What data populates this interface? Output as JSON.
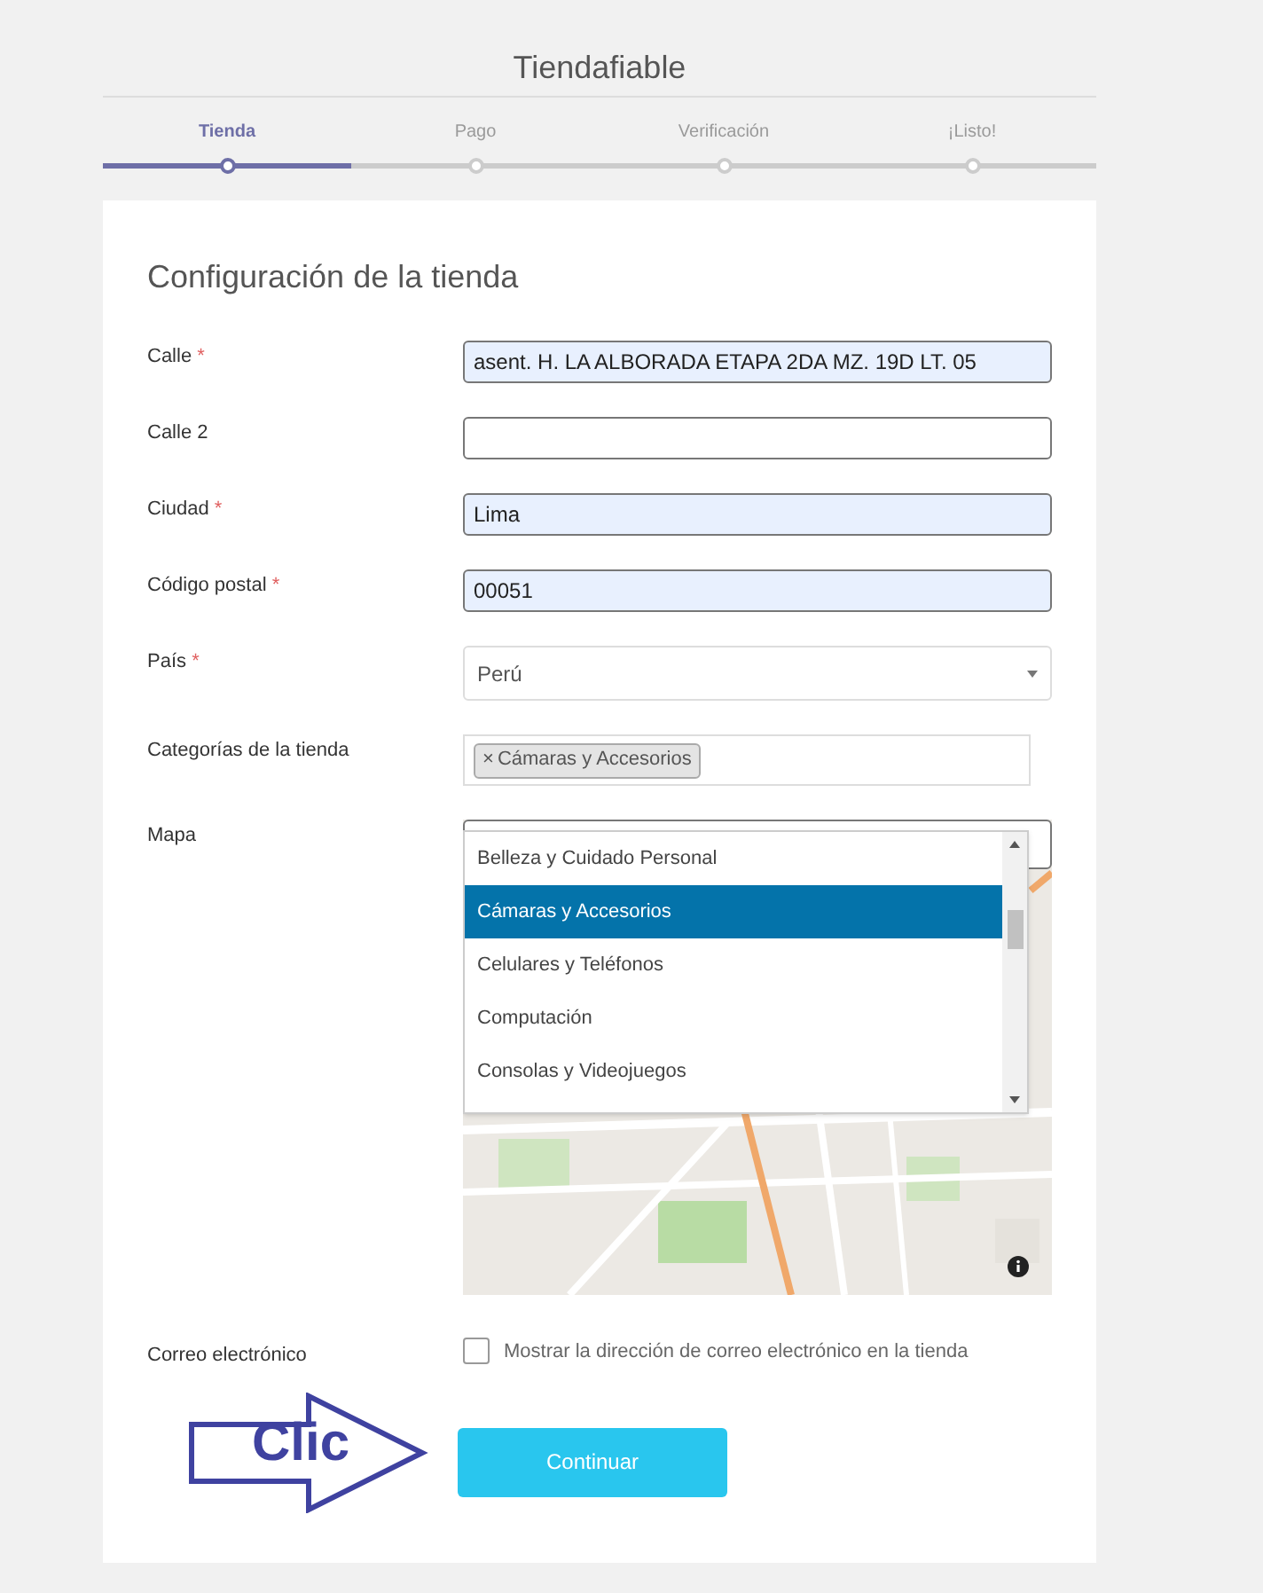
{
  "title": "Tiendafiable",
  "steps": [
    {
      "label": "Tienda",
      "selected": true
    },
    {
      "label": "Pago",
      "selected": false
    },
    {
      "label": "Verificación",
      "selected": false
    },
    {
      "label": "¡Listo!",
      "selected": false
    }
  ],
  "progress": {
    "level": 0.25
  },
  "form": {
    "heading": "Configuración de la tienda",
    "fields": [
      {
        "kind": "text",
        "label": "Calle",
        "required_mark": "*",
        "value": "asent. H. LA ALBORADA ETAPA 2DA MZ. 19D LT. 05",
        "autofilled": true
      },
      {
        "kind": "text",
        "label": "Calle 2",
        "autofilled": false
      },
      {
        "kind": "text",
        "label": "Ciudad",
        "required_mark": "*",
        "value": "Lima",
        "autofilled": true
      },
      {
        "kind": "text",
        "label": "Código postal",
        "required_mark": "*",
        "value": "00051",
        "autofilled": true
      },
      {
        "kind": "select",
        "label": "País",
        "required_mark": "*",
        "value": "Perú"
      },
      {
        "kind": "tags",
        "label": "Categorías de la tienda",
        "tags": [
          {
            "remove": "×",
            "label": "Cámaras y Accesorios"
          }
        ]
      },
      {
        "kind": "map",
        "label": "Mapa",
        "options": [
          {
            "label": "Belleza y Cuidado Personal",
            "selected": false
          },
          {
            "label": "Cámaras y Accesorios",
            "selected": true
          },
          {
            "label": "Celulares y Teléfonos",
            "selected": false
          },
          {
            "label": "Computación",
            "selected": false
          },
          {
            "label": "Consolas y Videojuegos",
            "selected": false
          }
        ]
      },
      {
        "kind": "checkbox",
        "label": "Correo electrónico",
        "text": "Mostrar la dirección de correo electrónico en la tienda",
        "checked": false
      }
    ]
  },
  "button": "Continuar",
  "annotation": "Clic"
}
